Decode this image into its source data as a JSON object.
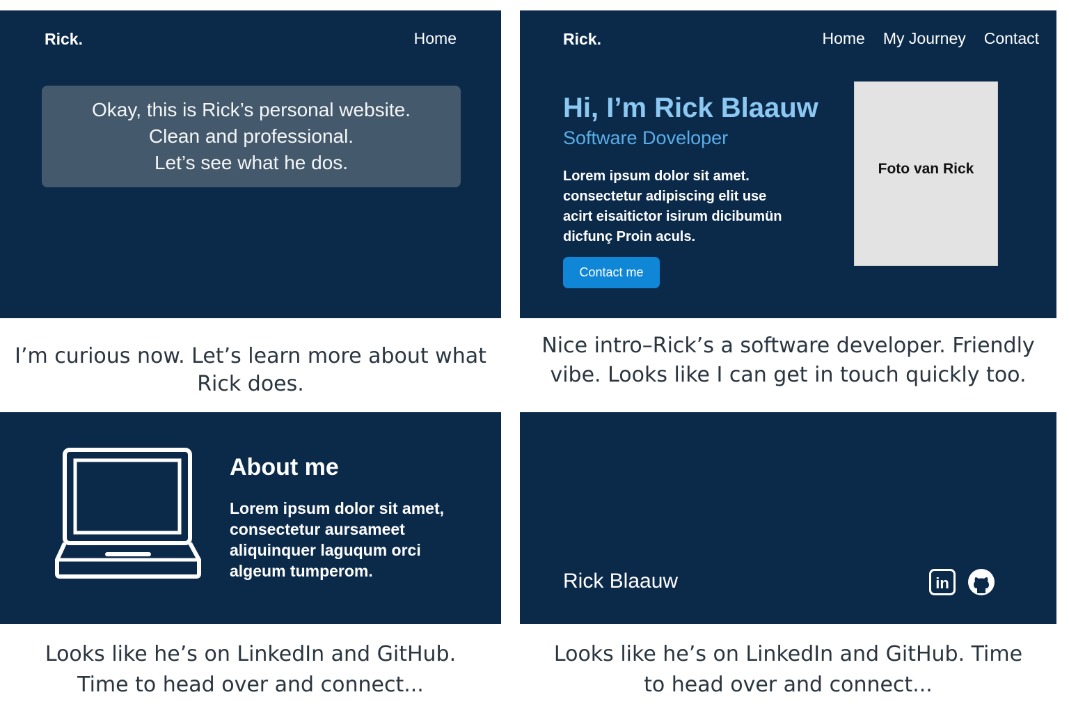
{
  "panel1": {
    "logo": "Rick.",
    "nav": [
      "Home"
    ],
    "speech_lines": [
      "Okay, this is Rick’s personal website.",
      "Clean and professional.",
      "Let’s see what he dos."
    ]
  },
  "caption1": {
    "lines": [
      "I’m curious now. Let’s learn more about what",
      "Rick does."
    ]
  },
  "panel2": {
    "logo": "Rick.",
    "nav": [
      "Home",
      "My Journey",
      "Contact"
    ],
    "hero_title": "Hi, I’m Rick Blaauw",
    "hero_subtitle": "Software Doveloper",
    "hero_body_lines": [
      "Lorem ipsum dolor sit amet.",
      "consectetur adipiscing elit use",
      "acirt eisaitictor isirum dicibumün",
      "dicfunç Proin aculs."
    ],
    "contact_button": "Contact me",
    "photo_label": "Foto van Rick"
  },
  "caption2": {
    "lines": [
      "Nice intro–Rick’s a software developer. Friendly",
      "vibe. Looks like I can get in touch quickly too."
    ]
  },
  "panel3": {
    "about_title": "About me",
    "about_body_lines": [
      "Lorem ipsum dolor sit amet,",
      "consectetur aursameet",
      "aliquinquer laguqum orci",
      "algeum tumperom."
    ],
    "icon": "laptop-icon"
  },
  "caption3": {
    "lines": [
      "Looks like he’s on LinkedIn and GitHub.",
      "Time to head over and connect..."
    ]
  },
  "panel4": {
    "footer_name": "Rick Blaauw",
    "icons": [
      "linkedin-icon",
      "github-icon"
    ],
    "linkedin_text": "in"
  },
  "caption4": {
    "lines": [
      "Looks like he’s on LinkedIn and GitHub. Time",
      "to head over and connect..."
    ]
  },
  "colors": {
    "panel_bg": "#0b2a4a",
    "speech_bg": "#44596b",
    "hero_title": "#8cc8f2",
    "hero_subtitle": "#5aaee8",
    "button_bg": "#0f86d6",
    "photo_bg": "#e3e3e3",
    "caption_text": "#2a3540"
  }
}
